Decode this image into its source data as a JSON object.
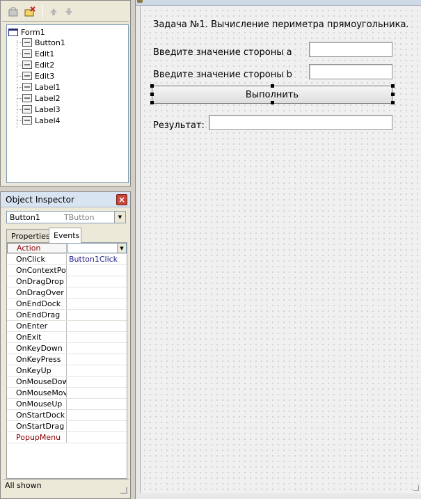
{
  "tree": {
    "items": [
      {
        "label": "Form1",
        "level": 0
      },
      {
        "label": "Button1",
        "level": 1
      },
      {
        "label": "Edit1",
        "level": 1
      },
      {
        "label": "Edit2",
        "level": 1
      },
      {
        "label": "Edit3",
        "level": 1
      },
      {
        "label": "Label1",
        "level": 1
      },
      {
        "label": "Label2",
        "level": 1
      },
      {
        "label": "Label3",
        "level": 1
      },
      {
        "label": "Label4",
        "level": 1
      }
    ]
  },
  "inspector": {
    "title": "Object Inspector",
    "close": "×",
    "selected_component": "Button1",
    "selected_type": "TButton",
    "tabs": [
      {
        "label": "Properties",
        "active": false
      },
      {
        "label": "Events",
        "active": true
      }
    ],
    "events": [
      {
        "name": "Action",
        "value": "",
        "ref": true
      },
      {
        "name": "OnClick",
        "value": "Button1Click"
      },
      {
        "name": "OnContextPopup",
        "value": ""
      },
      {
        "name": "OnDragDrop",
        "value": ""
      },
      {
        "name": "OnDragOver",
        "value": ""
      },
      {
        "name": "OnEndDock",
        "value": ""
      },
      {
        "name": "OnEndDrag",
        "value": ""
      },
      {
        "name": "OnEnter",
        "value": ""
      },
      {
        "name": "OnExit",
        "value": ""
      },
      {
        "name": "OnKeyDown",
        "value": ""
      },
      {
        "name": "OnKeyPress",
        "value": ""
      },
      {
        "name": "OnKeyUp",
        "value": ""
      },
      {
        "name": "OnMouseDown",
        "value": ""
      },
      {
        "name": "OnMouseMove",
        "value": ""
      },
      {
        "name": "OnMouseUp",
        "value": ""
      },
      {
        "name": "OnStartDock",
        "value": ""
      },
      {
        "name": "OnStartDrag",
        "value": ""
      },
      {
        "name": "PopupMenu",
        "value": "",
        "ref": true
      }
    ],
    "status": "All shown"
  },
  "form": {
    "task_label": "Задача №1. Вычисление периметра прямоугольника.",
    "side_a_label": "Введите значение стороны a",
    "side_b_label": "Введите значение стороны b",
    "run_button": "Выполнить",
    "result_label": "Результат:",
    "edit1_value": "",
    "edit2_value": "",
    "edit3_value": ""
  },
  "colors": {
    "reference_property": "#8b0000",
    "event_value": "#1a1a8c",
    "close_button": "#c8453a"
  }
}
